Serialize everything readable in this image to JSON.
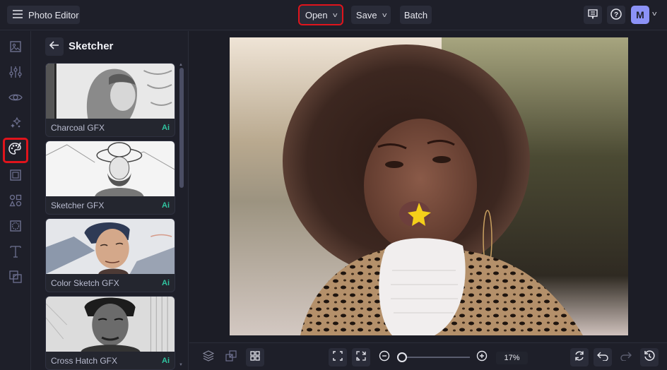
{
  "header": {
    "app_title": "Photo Editor",
    "open_label": "Open",
    "save_label": "Save",
    "batch_label": "Batch",
    "avatar_initial": "M"
  },
  "sidebar": {
    "items": [
      {
        "name": "image",
        "active": false
      },
      {
        "name": "adjustments",
        "active": false
      },
      {
        "name": "eye",
        "active": false
      },
      {
        "name": "effects",
        "active": false
      },
      {
        "name": "artsy",
        "active": true
      },
      {
        "name": "frames",
        "active": false
      },
      {
        "name": "graphics",
        "active": false
      },
      {
        "name": "overlays",
        "active": false
      },
      {
        "name": "text",
        "active": false
      },
      {
        "name": "layers-overlay",
        "active": false
      }
    ]
  },
  "panel": {
    "title": "Sketcher",
    "cards": [
      {
        "label": "Charcoal GFX",
        "badge": "Ai"
      },
      {
        "label": "Sketcher GFX",
        "badge": "Ai"
      },
      {
        "label": "Color Sketch GFX",
        "badge": "Ai"
      },
      {
        "label": "Cross Hatch GFX",
        "badge": "Ai"
      }
    ]
  },
  "bottombar": {
    "zoom_level": "17%",
    "zoom_fraction": 0.0
  },
  "colors": {
    "accent": "#8c92f6",
    "highlight": "#e0141c",
    "ai_badge": "#30c4a0",
    "background": "#1e1f29"
  }
}
